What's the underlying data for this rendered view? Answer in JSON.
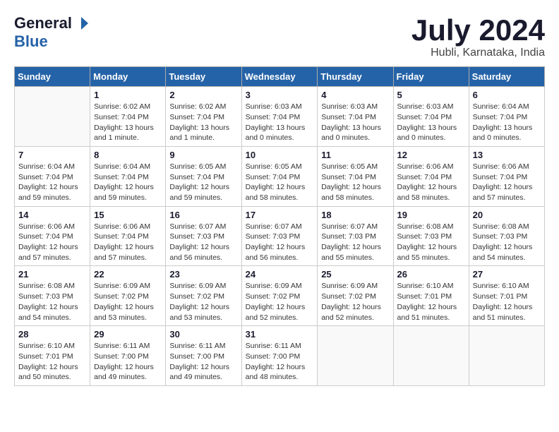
{
  "header": {
    "logo_general": "General",
    "logo_blue": "Blue",
    "title": "July 2024",
    "location": "Hubli, Karnataka, India"
  },
  "days_of_week": [
    "Sunday",
    "Monday",
    "Tuesday",
    "Wednesday",
    "Thursday",
    "Friday",
    "Saturday"
  ],
  "weeks": [
    [
      {
        "day": "",
        "info": ""
      },
      {
        "day": "1",
        "info": "Sunrise: 6:02 AM\nSunset: 7:04 PM\nDaylight: 13 hours\nand 1 minute."
      },
      {
        "day": "2",
        "info": "Sunrise: 6:02 AM\nSunset: 7:04 PM\nDaylight: 13 hours\nand 1 minute."
      },
      {
        "day": "3",
        "info": "Sunrise: 6:03 AM\nSunset: 7:04 PM\nDaylight: 13 hours\nand 0 minutes."
      },
      {
        "day": "4",
        "info": "Sunrise: 6:03 AM\nSunset: 7:04 PM\nDaylight: 13 hours\nand 0 minutes."
      },
      {
        "day": "5",
        "info": "Sunrise: 6:03 AM\nSunset: 7:04 PM\nDaylight: 13 hours\nand 0 minutes."
      },
      {
        "day": "6",
        "info": "Sunrise: 6:04 AM\nSunset: 7:04 PM\nDaylight: 13 hours\nand 0 minutes."
      }
    ],
    [
      {
        "day": "7",
        "info": "Sunrise: 6:04 AM\nSunset: 7:04 PM\nDaylight: 12 hours\nand 59 minutes."
      },
      {
        "day": "8",
        "info": "Sunrise: 6:04 AM\nSunset: 7:04 PM\nDaylight: 12 hours\nand 59 minutes."
      },
      {
        "day": "9",
        "info": "Sunrise: 6:05 AM\nSunset: 7:04 PM\nDaylight: 12 hours\nand 59 minutes."
      },
      {
        "day": "10",
        "info": "Sunrise: 6:05 AM\nSunset: 7:04 PM\nDaylight: 12 hours\nand 58 minutes."
      },
      {
        "day": "11",
        "info": "Sunrise: 6:05 AM\nSunset: 7:04 PM\nDaylight: 12 hours\nand 58 minutes."
      },
      {
        "day": "12",
        "info": "Sunrise: 6:06 AM\nSunset: 7:04 PM\nDaylight: 12 hours\nand 58 minutes."
      },
      {
        "day": "13",
        "info": "Sunrise: 6:06 AM\nSunset: 7:04 PM\nDaylight: 12 hours\nand 57 minutes."
      }
    ],
    [
      {
        "day": "14",
        "info": "Sunrise: 6:06 AM\nSunset: 7:04 PM\nDaylight: 12 hours\nand 57 minutes."
      },
      {
        "day": "15",
        "info": "Sunrise: 6:06 AM\nSunset: 7:04 PM\nDaylight: 12 hours\nand 57 minutes."
      },
      {
        "day": "16",
        "info": "Sunrise: 6:07 AM\nSunset: 7:03 PM\nDaylight: 12 hours\nand 56 minutes."
      },
      {
        "day": "17",
        "info": "Sunrise: 6:07 AM\nSunset: 7:03 PM\nDaylight: 12 hours\nand 56 minutes."
      },
      {
        "day": "18",
        "info": "Sunrise: 6:07 AM\nSunset: 7:03 PM\nDaylight: 12 hours\nand 55 minutes."
      },
      {
        "day": "19",
        "info": "Sunrise: 6:08 AM\nSunset: 7:03 PM\nDaylight: 12 hours\nand 55 minutes."
      },
      {
        "day": "20",
        "info": "Sunrise: 6:08 AM\nSunset: 7:03 PM\nDaylight: 12 hours\nand 54 minutes."
      }
    ],
    [
      {
        "day": "21",
        "info": "Sunrise: 6:08 AM\nSunset: 7:03 PM\nDaylight: 12 hours\nand 54 minutes."
      },
      {
        "day": "22",
        "info": "Sunrise: 6:09 AM\nSunset: 7:02 PM\nDaylight: 12 hours\nand 53 minutes."
      },
      {
        "day": "23",
        "info": "Sunrise: 6:09 AM\nSunset: 7:02 PM\nDaylight: 12 hours\nand 53 minutes."
      },
      {
        "day": "24",
        "info": "Sunrise: 6:09 AM\nSunset: 7:02 PM\nDaylight: 12 hours\nand 52 minutes."
      },
      {
        "day": "25",
        "info": "Sunrise: 6:09 AM\nSunset: 7:02 PM\nDaylight: 12 hours\nand 52 minutes."
      },
      {
        "day": "26",
        "info": "Sunrise: 6:10 AM\nSunset: 7:01 PM\nDaylight: 12 hours\nand 51 minutes."
      },
      {
        "day": "27",
        "info": "Sunrise: 6:10 AM\nSunset: 7:01 PM\nDaylight: 12 hours\nand 51 minutes."
      }
    ],
    [
      {
        "day": "28",
        "info": "Sunrise: 6:10 AM\nSunset: 7:01 PM\nDaylight: 12 hours\nand 50 minutes."
      },
      {
        "day": "29",
        "info": "Sunrise: 6:11 AM\nSunset: 7:00 PM\nDaylight: 12 hours\nand 49 minutes."
      },
      {
        "day": "30",
        "info": "Sunrise: 6:11 AM\nSunset: 7:00 PM\nDaylight: 12 hours\nand 49 minutes."
      },
      {
        "day": "31",
        "info": "Sunrise: 6:11 AM\nSunset: 7:00 PM\nDaylight: 12 hours\nand 48 minutes."
      },
      {
        "day": "",
        "info": ""
      },
      {
        "day": "",
        "info": ""
      },
      {
        "day": "",
        "info": ""
      }
    ]
  ]
}
